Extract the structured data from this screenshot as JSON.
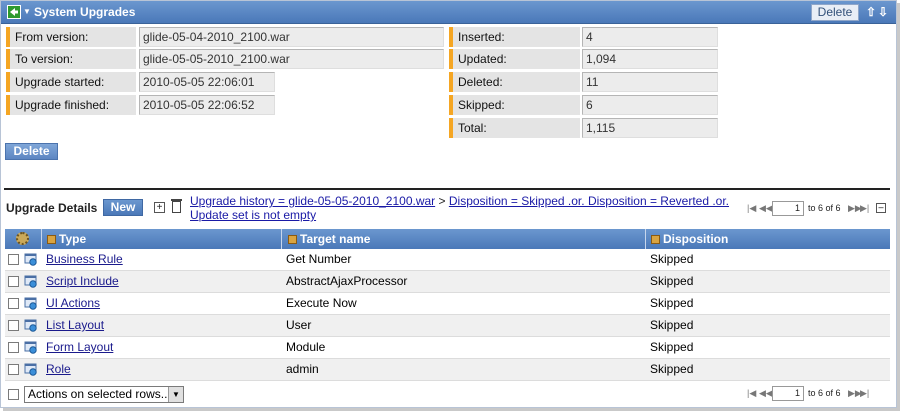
{
  "title": "System Upgrades",
  "title_delete": "Delete",
  "fields_left": [
    {
      "label": "From version:",
      "value": "glide-05-04-2010_2100.war"
    },
    {
      "label": "To version:",
      "value": "glide-05-05-2010_2100.war"
    },
    {
      "label": "Upgrade started:",
      "value": "2010-05-05 22:06:01"
    },
    {
      "label": "Upgrade finished:",
      "value": "2010-05-05 22:06:52"
    }
  ],
  "fields_right": [
    {
      "label": "Inserted:",
      "value": "4"
    },
    {
      "label": "Updated:",
      "value": "1,094"
    },
    {
      "label": "Deleted:",
      "value": "11"
    },
    {
      "label": "Skipped:",
      "value": "6"
    },
    {
      "label": "Total:",
      "value": "1,115"
    }
  ],
  "delete_label": "Delete",
  "details": {
    "title": "Upgrade Details",
    "new_label": "New",
    "breadcrumb_1": "Upgrade history = glide-05-05-2010_2100.war",
    "breadcrumb_sep": ">",
    "breadcrumb_2": "Disposition = Skipped .or. Disposition = Reverted .or. Update set is not empty",
    "pager_value": "1",
    "pager_text": "to 6 of 6"
  },
  "columns": [
    "Type",
    "Target name",
    "Disposition"
  ],
  "rows": [
    {
      "type": "Business Rule",
      "target": "Get Number",
      "disposition": "Skipped"
    },
    {
      "type": "Script Include",
      "target": "AbstractAjaxProcessor",
      "disposition": "Skipped"
    },
    {
      "type": "UI Actions",
      "target": "Execute Now",
      "disposition": "Skipped"
    },
    {
      "type": "List Layout",
      "target": "User",
      "disposition": "Skipped"
    },
    {
      "type": "Form Layout",
      "target": "Module",
      "disposition": "Skipped"
    },
    {
      "type": "Role",
      "target": "admin",
      "disposition": "Skipped"
    }
  ],
  "footer": {
    "actions_label": "Actions on selected rows...",
    "pager_value": "1",
    "pager_text": "to 6 of 6"
  },
  "colors": {
    "header_blue": "#5a86c4",
    "label_accent": "#f5a623",
    "link": "#1a1a8c"
  }
}
